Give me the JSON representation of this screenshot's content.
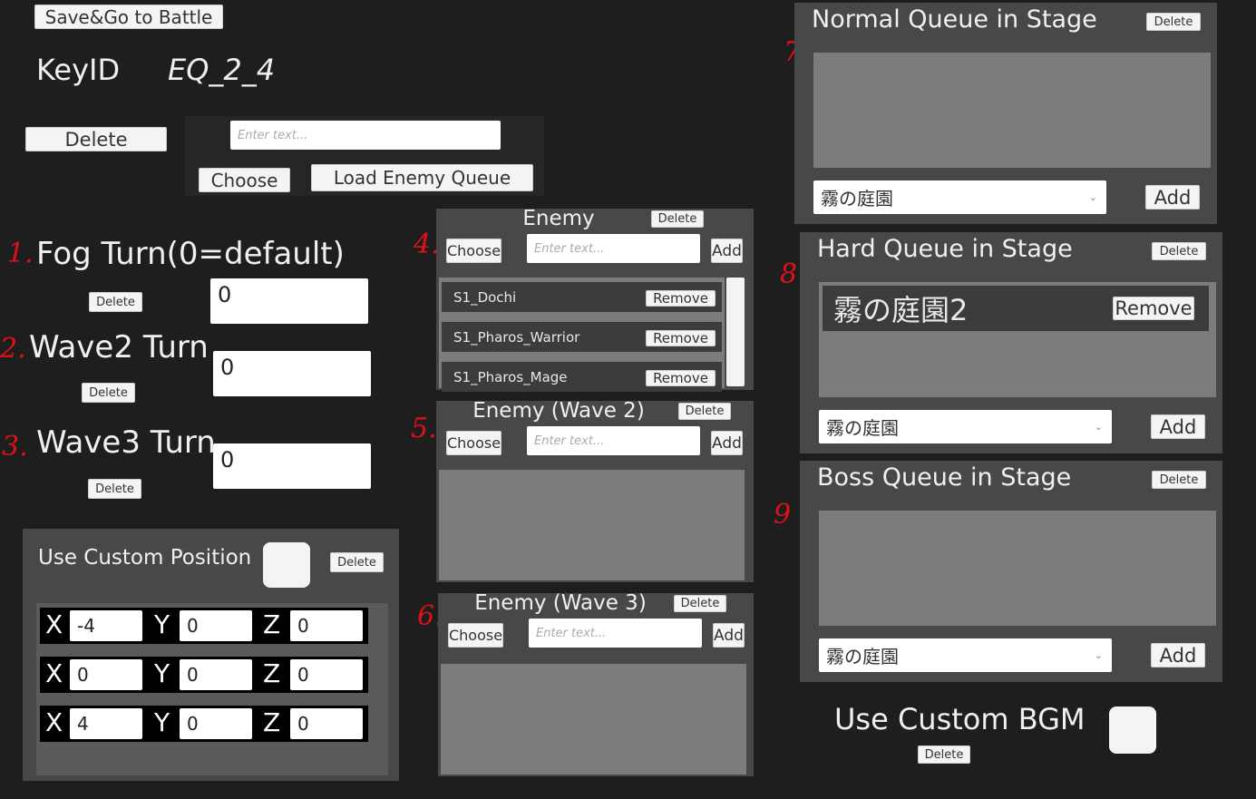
{
  "top": {
    "save_go": "Save&Go to Battle",
    "keyid_label": "KeyID",
    "keyid_value": "EQ_2_4",
    "delete": "Delete",
    "load_input_placeholder": "Enter text...",
    "choose": "Choose",
    "load_enemy_queue": "Load Enemy Queue"
  },
  "annotations": [
    "1.",
    "2.",
    "3.",
    "4.",
    "5.",
    "6.",
    "7",
    "8",
    "9"
  ],
  "turns": [
    {
      "label": "Fog Turn(0=default)",
      "value": "0",
      "delete": "Delete"
    },
    {
      "label": "Wave2 Turn",
      "value": "0",
      "delete": "Delete"
    },
    {
      "label": "Wave3 Turn",
      "value": "0",
      "delete": "Delete"
    }
  ],
  "custom_position": {
    "label": "Use Custom Position",
    "checked": false,
    "delete": "Delete",
    "axes": [
      "X",
      "Y",
      "Z"
    ],
    "rows": [
      [
        "-4",
        "0",
        "0"
      ],
      [
        "0",
        "0",
        "0"
      ],
      [
        "4",
        "0",
        "0"
      ]
    ]
  },
  "enemy_panels": [
    {
      "title": "Enemy",
      "delete": "Delete",
      "choose": "Choose",
      "placeholder": "Enter text...",
      "add": "Add",
      "items": [
        {
          "name": "S1_Dochi",
          "remove": "Remove"
        },
        {
          "name": "S1_Pharos_Warrior",
          "remove": "Remove"
        },
        {
          "name": "S1_Pharos_Mage",
          "remove": "Remove"
        }
      ]
    },
    {
      "title": "Enemy (Wave 2)",
      "delete": "Delete",
      "choose": "Choose",
      "placeholder": "Enter text...",
      "add": "Add",
      "items": []
    },
    {
      "title": "Enemy (Wave 3)",
      "delete": "Delete",
      "choose": "Choose",
      "placeholder": "Enter text...",
      "add": "Add",
      "items": []
    }
  ],
  "queues": [
    {
      "title": "Normal Queue in Stage",
      "delete": "Delete",
      "items": [],
      "selected": "霧の庭園",
      "add": "Add"
    },
    {
      "title": "Hard Queue in Stage",
      "delete": "Delete",
      "items": [
        {
          "name": "霧の庭園2",
          "remove": "Remove"
        }
      ],
      "selected": "霧の庭園",
      "add": "Add"
    },
    {
      "title": "Boss Queue in Stage",
      "delete": "Delete",
      "items": [],
      "selected": "霧の庭園",
      "add": "Add"
    }
  ],
  "bgm": {
    "label": "Use Custom BGM",
    "checked": false,
    "delete": "Delete"
  },
  "colors": {
    "background": "#1e1e1e",
    "panel": "#484848",
    "list": "#7c7c7c",
    "annotation": "#e0101a"
  }
}
